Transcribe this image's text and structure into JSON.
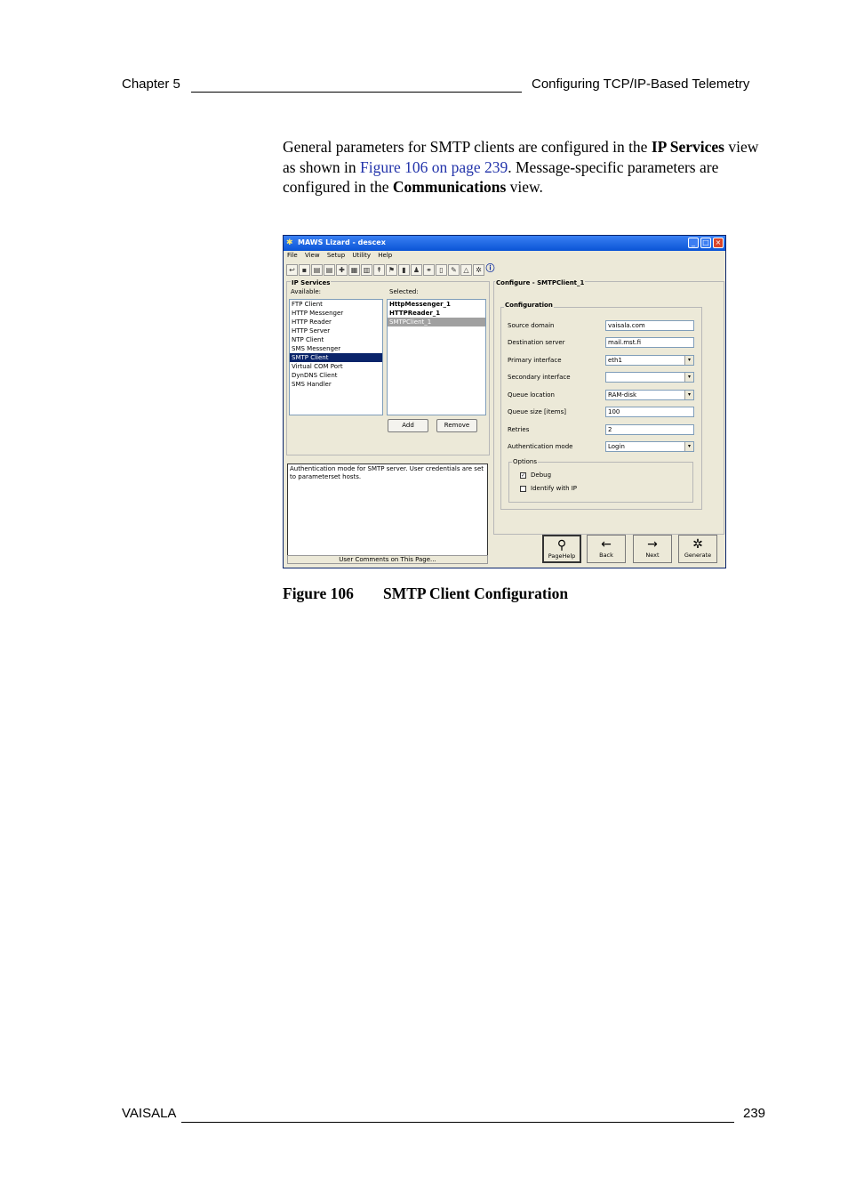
{
  "header": {
    "chapter": "Chapter 5",
    "section": "Configuring TCP/IP-Based Telemetry"
  },
  "body": {
    "p1_a": "General parameters for SMTP clients are configured in the ",
    "p1_b": "IP Services",
    "p1_c": " view as shown in ",
    "p1_link": "Figure 106 on page 239",
    "p1_d": ". Message-specific parameters are configured in the ",
    "p1_e": "Communications",
    "p1_f": " view."
  },
  "screenshot": {
    "window_title": "MAWS Lizard - descex",
    "menu": [
      "File",
      "View",
      "Setup",
      "Utility",
      "Help"
    ],
    "ip_services_label": "IP Services",
    "available_label": "Available:",
    "selected_label": "Selected:",
    "available": [
      "FTP Client",
      "HTTP Messenger",
      "HTTP Reader",
      "HTTP Server",
      "NTP Client",
      "SMS Messenger",
      "SMTP Client",
      "Virtual COM Port",
      "DynDNS Client",
      "SMS Handler"
    ],
    "selected": [
      "HttpMessenger_1",
      "HTTPReader_1",
      "SMTPClient_1"
    ],
    "add_label": "Add",
    "remove_label": "Remove",
    "help_text": "Authentication mode for SMTP server. User credentials are set to parameterset hosts.",
    "comments_label": "User Comments on This Page...",
    "configure_label": "Configure - SMTPClient_1",
    "configuration_label": "Configuration",
    "fields": {
      "source_domain_label": "Source domain",
      "source_domain_value": "vaisala.com",
      "destination_server_label": "Destination server",
      "destination_server_value": "mail.mst.fi",
      "primary_interface_label": "Primary interface",
      "primary_interface_value": "eth1",
      "secondary_interface_label": "Secondary interface",
      "secondary_interface_value": "",
      "queue_location_label": "Queue location",
      "queue_location_value": "RAM-disk",
      "queue_size_label": "Queue size [items]",
      "queue_size_value": "100",
      "retries_label": "Retries",
      "retries_value": "2",
      "auth_mode_label": "Authentication mode",
      "auth_mode_value": "Login"
    },
    "options_label": "Options",
    "debug_label": "Debug",
    "debug_checked": "✓",
    "identify_label": "Identify with IP",
    "nav": {
      "pagehelp": "PageHelp",
      "back": "Back",
      "next": "Next",
      "generate": "Generate"
    }
  },
  "figure": {
    "number": "Figure 106",
    "caption": "SMTP Client Configuration"
  },
  "footer": {
    "brand": "VAISALA",
    "page": "239"
  }
}
